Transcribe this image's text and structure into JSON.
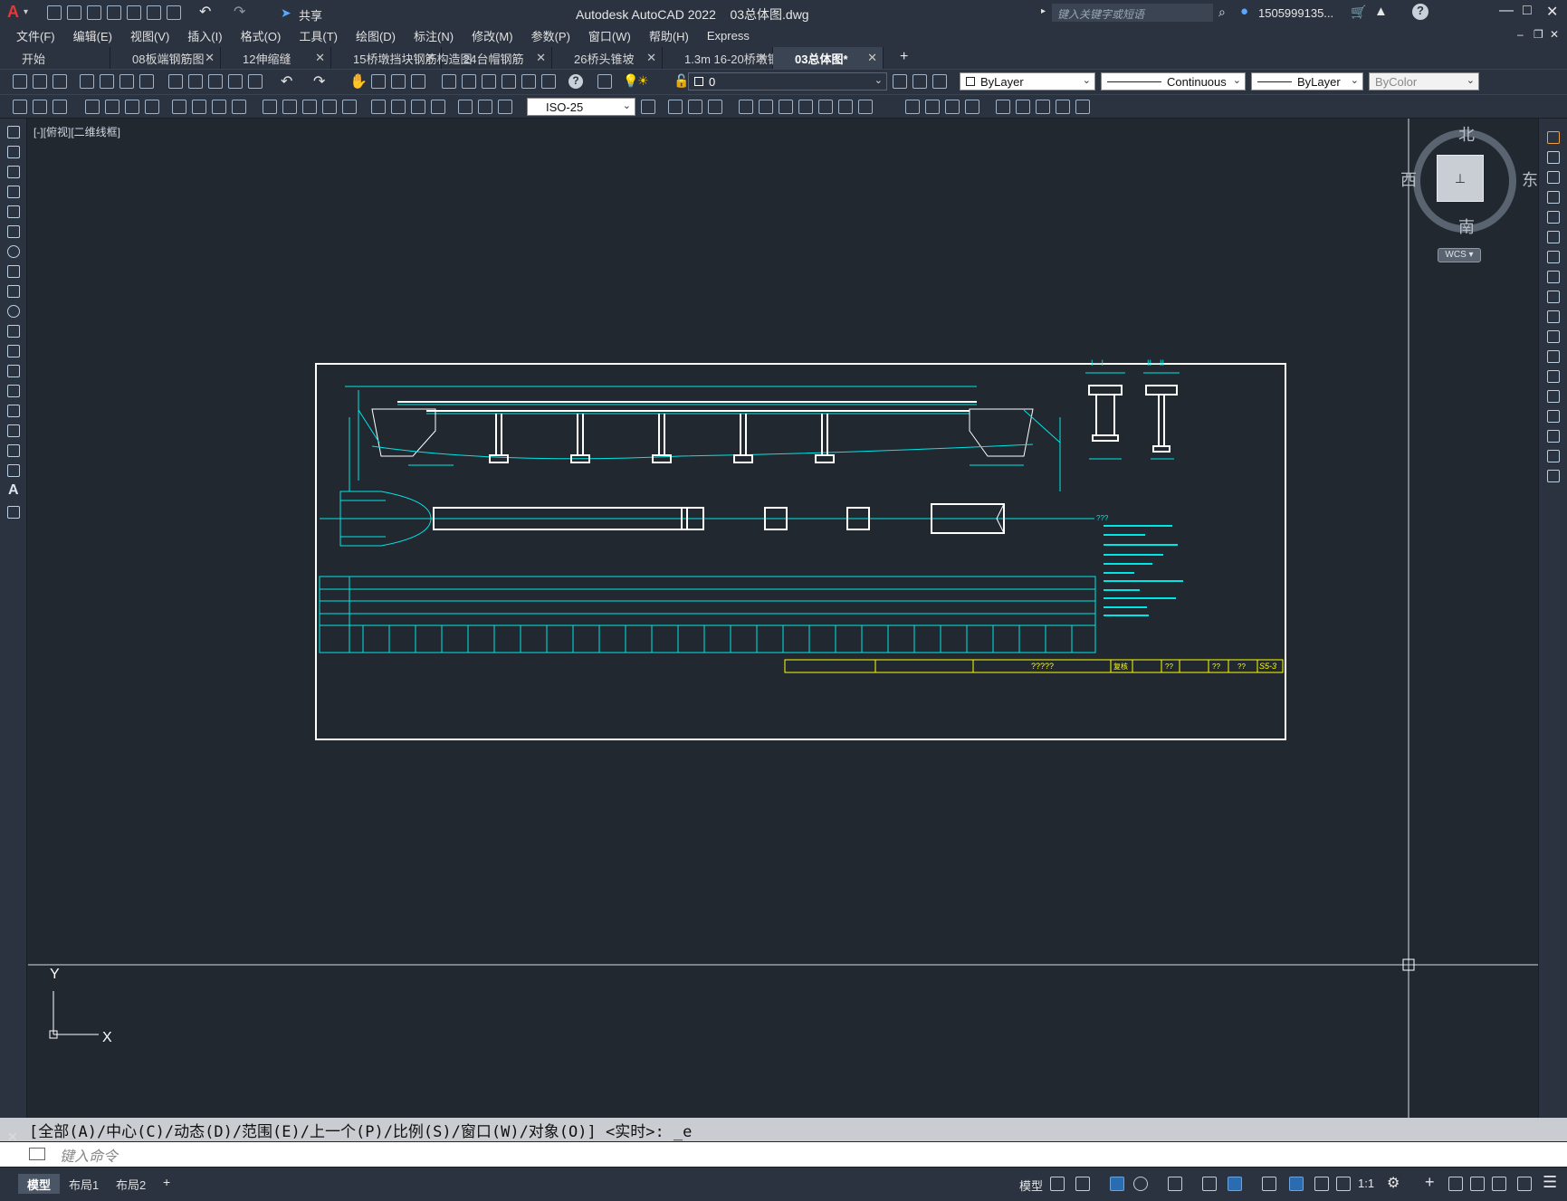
{
  "titlebar": {
    "app_title": "Autodesk AutoCAD 2022    03总体图.dwg",
    "share_label": "共享",
    "search_placeholder": "键入关键字或短语",
    "user_name": "1505999135... "
  },
  "menu": [
    "文件(F)",
    "编辑(E)",
    "视图(V)",
    "插入(I)",
    "格式(O)",
    "工具(T)",
    "绘图(D)",
    "标注(N)",
    "修改(M)",
    "参数(P)",
    "窗口(W)",
    "帮助(H)",
    "Express"
  ],
  "file_tabs": [
    {
      "label": "开始",
      "active": false,
      "closable": false
    },
    {
      "label": "08板端钢筋图",
      "active": false,
      "closable": true
    },
    {
      "label": "12伸缩缝",
      "active": false,
      "closable": true
    },
    {
      "label": "15桥墩挡块钢筋构造图",
      "active": false,
      "closable": true
    },
    {
      "label": "24台帽钢筋",
      "active": false,
      "closable": true
    },
    {
      "label": "26桥头锥坡",
      "active": false,
      "closable": true
    },
    {
      "label": "1.3m 16-20桥墩钢筋",
      "active": false,
      "closable": true
    },
    {
      "label": "03总体图*",
      "active": true,
      "closable": true
    }
  ],
  "properties": {
    "layer": "0",
    "color": "ByLayer",
    "linetype": "Continuous",
    "lineweight": "ByLayer",
    "plotstyle": "ByColor",
    "dimstyle": "ISO-25"
  },
  "viewport": {
    "label": "[-][俯视][二维线框]",
    "wcs": "WCS",
    "compass": {
      "north": "北",
      "south": "南",
      "east": "东",
      "west": "西"
    },
    "ucs_x": "X",
    "ucs_y": "Y"
  },
  "drawing": {
    "title_block": {
      "center_text": "?????",
      "sheet_no": "S5-3",
      "marks": [
        "复核",
        "??",
        "??",
        "??"
      ]
    },
    "section_labels": [
      "I—I",
      "II—II"
    ],
    "notes_heading": "???"
  },
  "command": {
    "history": "[全部(A)/中心(C)/动态(D)/范围(E)/上一个(P)/比例(S)/窗口(W)/对象(O)] <实时>: _e",
    "placeholder": "键入命令"
  },
  "status": {
    "layout_tabs": [
      "模型",
      "布局1",
      "布局2"
    ],
    "mode_label": "模型",
    "scale": "1:1"
  },
  "colors": {
    "background": "#212830",
    "ui": "#2b3340",
    "cad_cyan": "#00e6e6",
    "cad_white": "#ffffff",
    "cad_yellow": "#ffff00"
  }
}
